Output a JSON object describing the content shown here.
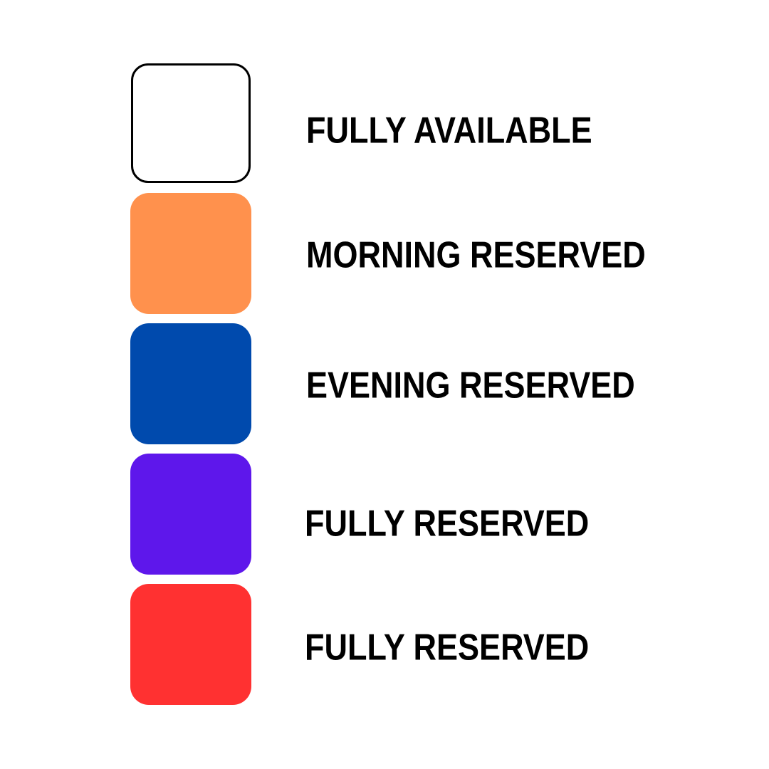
{
  "legend": {
    "items": [
      {
        "label": "FULLY AVAILABLE",
        "color": "#ffffff",
        "border": "#000000"
      },
      {
        "label": "MORNING RESERVED",
        "color": "#ff914d"
      },
      {
        "label": "EVENING RESERVED",
        "color": "#004aad"
      },
      {
        "label": "FULLY RESERVED",
        "color": "#5e17eb"
      },
      {
        "label": "FULLY RESERVED",
        "color": "#ff3131"
      }
    ]
  }
}
